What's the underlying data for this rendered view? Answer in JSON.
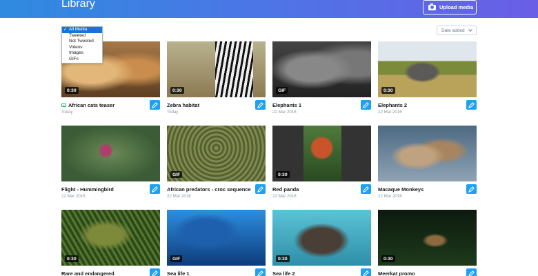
{
  "header": {
    "title": "Library",
    "upload_label": "Upload media",
    "gradient": [
      "#2f8be0",
      "#6a5ee6"
    ]
  },
  "filter": {
    "options": [
      "All Media",
      "Tweeted",
      "Not Tweeted",
      "Videos",
      "Images",
      "GIFs"
    ],
    "selected": "All Media",
    "selected_color": "#1a73d9"
  },
  "sort": {
    "label": "Date added"
  },
  "accent": "#1da1f2",
  "media": [
    {
      "name": "African cats teaser",
      "date": "Today",
      "badge": "0:30",
      "icon": "video-icon"
    },
    {
      "name": "Zebra habitat",
      "date": "Today",
      "badge": "0:30",
      "icon": ""
    },
    {
      "name": "Elephants 1",
      "date": "22 Mar 2016",
      "badge": "GIF",
      "icon": ""
    },
    {
      "name": "Elephants 2",
      "date": "22 Mar 2016",
      "badge": "0:30",
      "icon": ""
    },
    {
      "name": "Flight - Hummingbird",
      "date": "22 Mar 2016",
      "badge": "",
      "icon": ""
    },
    {
      "name": "African predators - croc sequence",
      "date": "22 Mar 2016",
      "badge": "GIF",
      "icon": ""
    },
    {
      "name": "Red panda",
      "date": "22 Mar 2016",
      "badge": "0:30",
      "icon": ""
    },
    {
      "name": "Macaque Monkeys",
      "date": "22 Mar 2016",
      "badge": "",
      "icon": ""
    },
    {
      "name": "Rare and endangered",
      "date": "",
      "badge": "0:30",
      "icon": ""
    },
    {
      "name": "Sea life 1",
      "date": "",
      "badge": "GIF",
      "icon": ""
    },
    {
      "name": "Sea life 2",
      "date": "",
      "badge": "0:30",
      "icon": ""
    },
    {
      "name": "Meerkat promo",
      "date": "",
      "badge": "0:30",
      "icon": ""
    }
  ]
}
